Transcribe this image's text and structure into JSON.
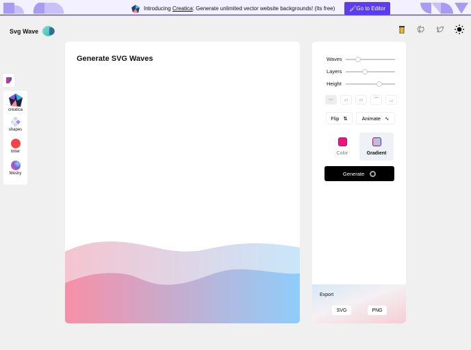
{
  "banner": {
    "intro": "Introducing ",
    "link": "Creatica",
    "rest": ": Generate unlimited vector website backgrounds! (Its free)",
    "button": "Go to Editor"
  },
  "header": {
    "title": "Svg Wave",
    "icons": [
      "buy-me-coffee-icon",
      "github-icon",
      "twitter-icon",
      "theme-toggle-icon"
    ]
  },
  "main": {
    "title": "Generate SVG Waves"
  },
  "controls": {
    "sliders": [
      {
        "label": "Waves",
        "value": 0.3
      },
      {
        "label": "Layers",
        "value": 0.45
      },
      {
        "label": "Height",
        "value": 0.7
      }
    ],
    "flip": "Flip",
    "animate": "Animate",
    "modes": [
      {
        "label": "Color",
        "color": "#ff0f7b",
        "selected": false
      },
      {
        "label": "Gradient",
        "selected": true
      }
    ],
    "generate": "Generate"
  },
  "export": {
    "title": "Export",
    "svg": "SVG",
    "png": "PNG"
  },
  "sidebar": {
    "items": [
      {
        "label": "creatica"
      },
      {
        "label": "shapes"
      },
      {
        "label": "tinter"
      },
      {
        "label": "Meshy"
      }
    ]
  }
}
